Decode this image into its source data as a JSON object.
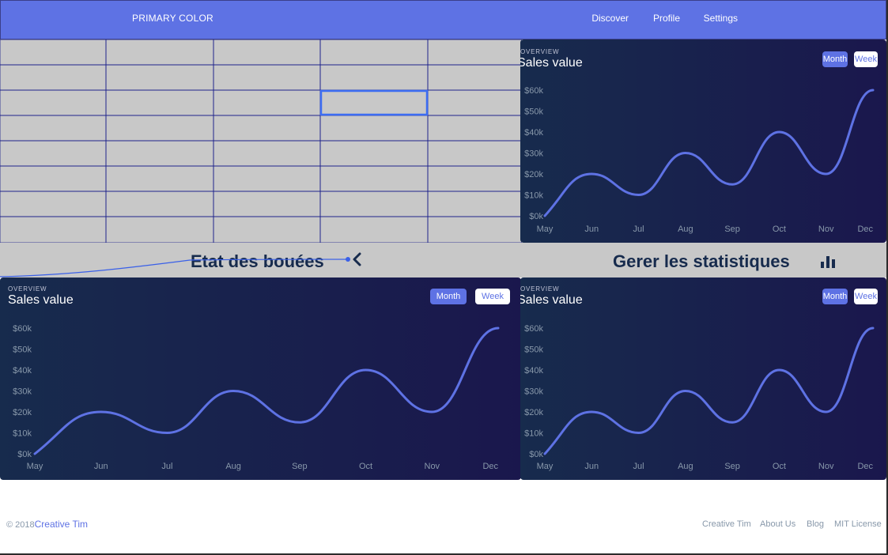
{
  "navbar": {
    "brand": "PRIMARY COLOR",
    "links": [
      "Discover",
      "Profile",
      "Settings"
    ],
    "color": "#5e72e4"
  },
  "grid": {
    "rows": 8,
    "cols": 5,
    "selected_row": 2,
    "selected_col": 3,
    "line_color": "#1a1f8a",
    "selected_color": "#3d6df2"
  },
  "band": {
    "left_title": "Etat des bouées",
    "left_icon": "chevron-left-icon",
    "right_title": "Gerer les statistiques",
    "right_icon": "bar-chart-icon"
  },
  "cards": [
    {
      "overview": "OVERVIEW",
      "title": "Sales value",
      "month_label": "Month",
      "week_label": "Week"
    },
    {
      "overview": "OVERVIEW",
      "title": "Sales value",
      "month_label": "Month",
      "week_label": "Week"
    },
    {
      "overview": "OVERVIEW",
      "title": "Sales value",
      "month_label": "Month",
      "week_label": "Week"
    }
  ],
  "chart_data": {
    "type": "line",
    "title": "Sales value",
    "categories": [
      "May",
      "Jun",
      "Jul",
      "Aug",
      "Sep",
      "Oct",
      "Nov",
      "Dec"
    ],
    "series": [
      {
        "values": [
          0,
          20,
          10,
          30,
          15,
          40,
          20,
          60
        ]
      }
    ],
    "y_ticks": [
      "$0k",
      "$10k",
      "$20k",
      "$30k",
      "$40k",
      "$50k",
      "$60k"
    ],
    "ylim": [
      0,
      60
    ],
    "grid": false,
    "line_color": "#5e72e4"
  },
  "footer": {
    "copyright": "© 2018",
    "brand": "Creative Tim",
    "links": [
      "Creative Tim",
      "About Us",
      "Blog",
      "MIT License"
    ]
  }
}
